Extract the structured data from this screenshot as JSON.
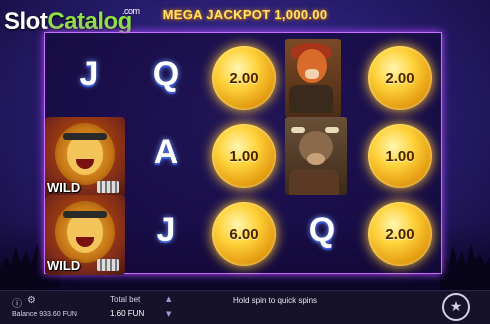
{
  "logo": {
    "slot": "Slot",
    "catalog": "Catalog",
    "com": ".com"
  },
  "jackpot": {
    "label": "MEGA JACKPOT 1,000.00"
  },
  "reels": [
    [
      {
        "type": "wild",
        "text": "WILD"
      },
      {
        "type": "wild",
        "text": "WILD"
      }
    ],
    [
      {
        "type": "letter",
        "text": "J"
      }
    ],
    [
      {
        "type": "letter",
        "text": "Q"
      },
      {
        "type": "letter",
        "text": "A"
      },
      {
        "type": "letter",
        "text": "J"
      }
    ],
    [
      {
        "type": "coin",
        "text": "2.00"
      },
      {
        "type": "coin",
        "text": "1.00"
      },
      {
        "type": "coin",
        "text": "6.00"
      }
    ],
    [
      {
        "type": "character",
        "text": "wolf"
      },
      {
        "type": "character",
        "text": "bull"
      },
      {
        "type": "letter",
        "text": "Q"
      }
    ],
    [
      {
        "type": "coin",
        "text": "2.00"
      },
      {
        "type": "coin",
        "text": "1.00"
      },
      {
        "type": "coin",
        "text": "2.00"
      }
    ]
  ],
  "symbols": {
    "r0c1": "J",
    "r0c2": "Q",
    "r0c3": "2.00",
    "r0c5": "2.00",
    "r1c2": "A",
    "r1c3": "1.00",
    "r1c5": "1.00",
    "r2c2": "J",
    "r2c3": "6.00",
    "r2c4": "Q",
    "r2c5": "2.00",
    "wild1": "WILD",
    "wild2": "WILD"
  },
  "bottom": {
    "balance": "Balance 933.60 FUN",
    "total_bet_label": "Total bet",
    "total_bet_value": "1.60 FUN",
    "hold_hint": "Hold spin to quick spins"
  },
  "icons": {
    "info": "info-icon",
    "settings": "gear-icon",
    "bet_up": "arrow-up-icon",
    "bet_down": "arrow-down-icon",
    "spin": "spin-icon"
  },
  "colors": {
    "background": "#2a1f74",
    "frame": "#c86bff",
    "coin": "#ffd23a",
    "jackpot": "#ffe36b",
    "logo_green": "#8ee04a"
  }
}
